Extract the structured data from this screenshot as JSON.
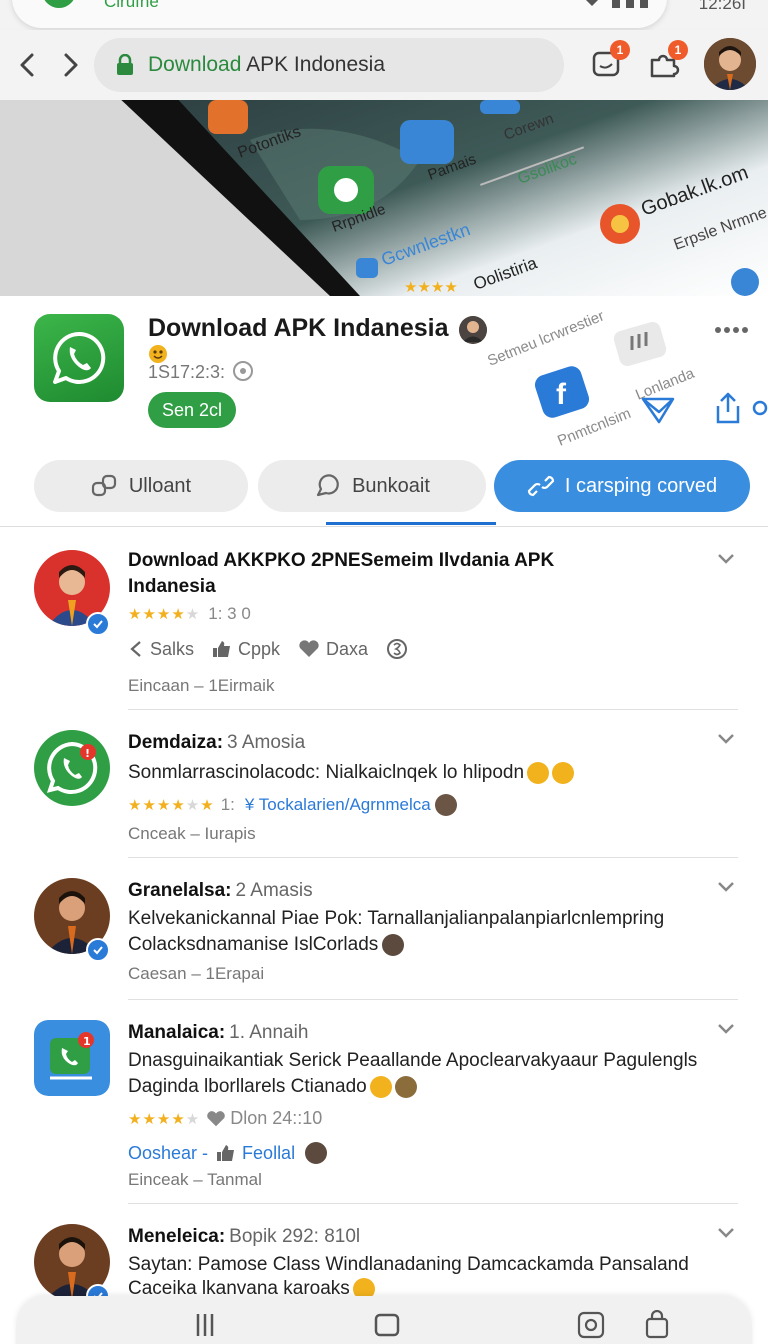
{
  "status_bar": {
    "left_text": "Cirufhe",
    "time": "12:26I"
  },
  "browser": {
    "url_domain": "Download",
    "url_rest": " APK Indonesia",
    "badge_1": "1",
    "badge_2": "1"
  },
  "hero": {
    "texts": [
      "Potontiks",
      "Pamais",
      "Corewn",
      "Gsolikoc",
      "Rrpnidle",
      "Gcwnlestkn",
      "Gobak.lk.om",
      "Erpsle Nrmne",
      "Oolistiria"
    ]
  },
  "app": {
    "title": "Download APK Indanesia",
    "meta": "1S17:2:3:",
    "send_label": "Sen 2cl",
    "overlay_texts": [
      "Setmeu lcrwrestier",
      "Lonlanda",
      "Pnmtcnlsim"
    ]
  },
  "actions": [
    {
      "label": "Ulloant",
      "icon": "link-icon"
    },
    {
      "label": "Bunkoait",
      "icon": "chat-icon"
    },
    {
      "label": "I carsping corved",
      "icon": "link-icon"
    }
  ],
  "feed": [
    {
      "name": "Download AKKPKO 2PNESemeim Ilvdania APK",
      "name_line2": "Indanesia",
      "rating_text": "1: 3 0",
      "reactions": [
        {
          "icon": "share-icon",
          "label": "Salks"
        },
        {
          "icon": "thumbs-up-icon",
          "label": "Cppk"
        },
        {
          "icon": "heart-icon",
          "label": "Daxa"
        }
      ],
      "footer": "Eincaan – 1Eirmaik"
    },
    {
      "name": "Demdaiza:",
      "sub": "3 Amosia",
      "line1": "Sonmlarrascinolacodc: Nialkaiclnqek lo hlipodn",
      "rating_text": "1: ",
      "link_text": "¥ Tockalarien/Agrnmelca",
      "footer": "Cnceak – Iurapis"
    },
    {
      "name": "Granelalsa:",
      "sub": "2 Amasis",
      "line1": "Kelvekanickannal Piae Pok: Tarnallanjalianpalanpiarlcnlempring",
      "line2": "Colacksdnamanise IslCorlads",
      "footer": "Caesan – 1Erapai"
    },
    {
      "name": "Manalaica:",
      "sub": "1. Annaih",
      "line1": "Dnasguinaikantiak Serick Peaallande Apoclearvakyaaur Pagulengls",
      "line2": "Daginda lborllarels Ctianado",
      "rating_text": "Dlon 24::10",
      "link_a": "Ooshear -",
      "link_b": "Feollal",
      "footer": "Einceak – Tanmal"
    },
    {
      "name": "Meneleica:",
      "sub": "Bopik 292:  810l",
      "line1": "Saytan: Pamose Class Windlanadaning Damcackamda Pansaland",
      "line2": "Caceika lkanvana karoaks"
    }
  ],
  "colors": {
    "brand_green": "#2f9e44",
    "accent_blue": "#3a8ee0",
    "badge_orange": "#ef5b2b",
    "star_yellow": "#f2b01e"
  }
}
